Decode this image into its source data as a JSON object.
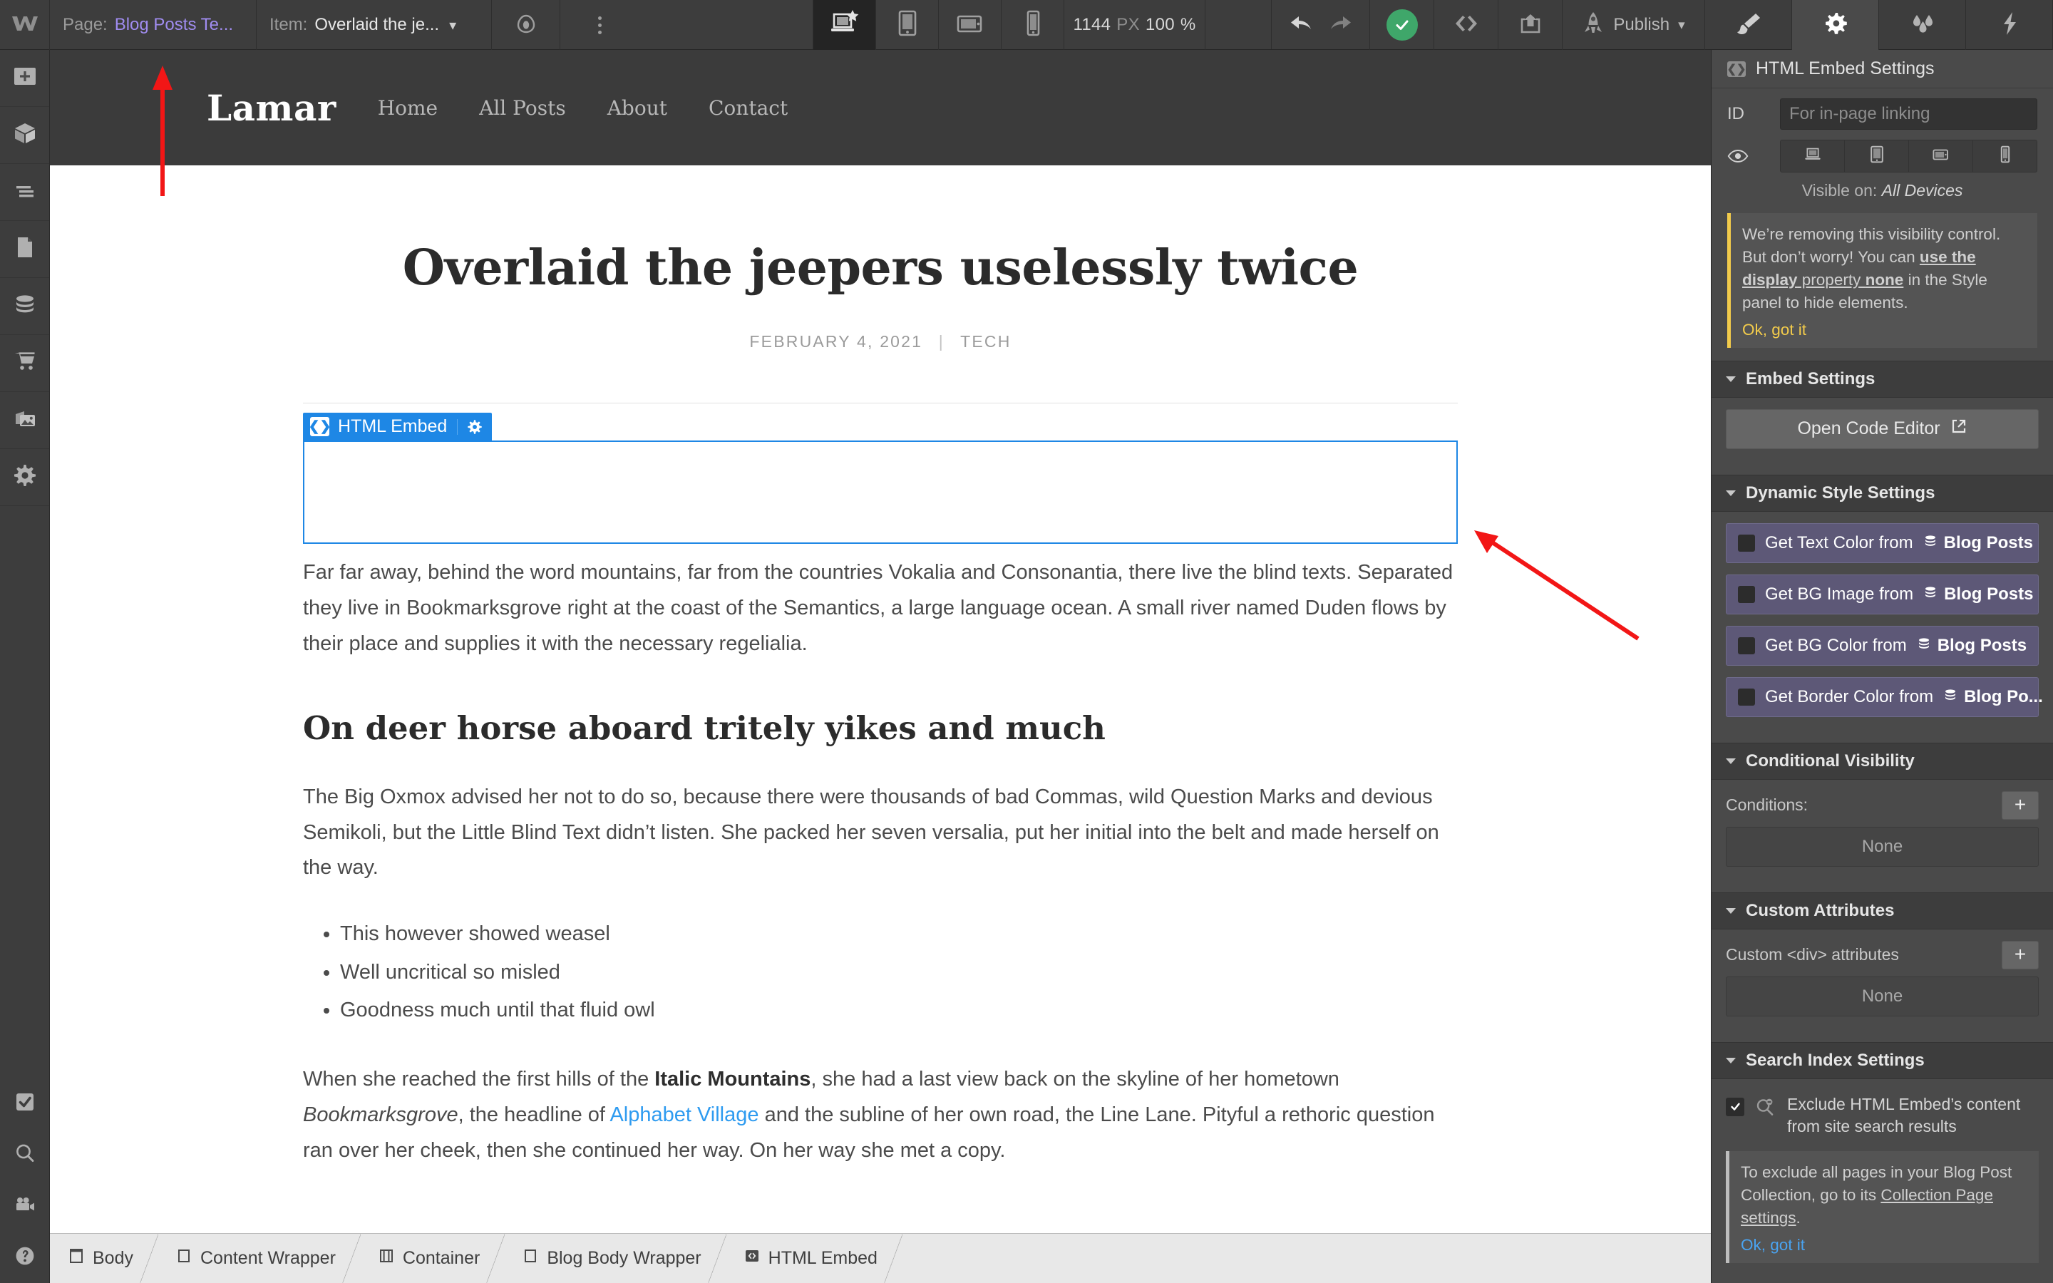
{
  "topbar": {
    "logo_icon": "webflow-logo-icon",
    "page_label": "Page:",
    "page_value": "Blog Posts Te...",
    "item_label": "Item:",
    "item_value": "Overlaid the je...",
    "preview_icon": "preview-eye-icon",
    "more_icon": "more-vertical-icon",
    "breakpoints": [
      {
        "name": "desktop-large-breakpoint",
        "icon": "laptop-star-icon",
        "active": true
      },
      {
        "name": "tablet-breakpoint",
        "icon": "tablet-portrait-icon",
        "active": false
      },
      {
        "name": "mobile-landscape-breakpoint",
        "icon": "mobile-landscape-icon",
        "active": false
      },
      {
        "name": "mobile-portrait-breakpoint",
        "icon": "mobile-portrait-icon",
        "active": false
      }
    ],
    "viewport_width": "1144",
    "viewport_unit": "PX",
    "zoom_value": "100",
    "zoom_unit": "%",
    "undo_icon": "undo-arrow-icon",
    "redo_icon": "redo-arrow-icon",
    "save_status_icon": "saved-check-icon",
    "code_icon": "code-brackets-icon",
    "export_icon": "share-export-icon",
    "publish_icon": "rocket-icon",
    "publish_label": "Publish",
    "publish_caret": "chevron-down-icon",
    "panel_tabs": [
      {
        "name": "style-panel-tab",
        "icon": "paintbrush-icon",
        "active": false
      },
      {
        "name": "settings-panel-tab",
        "icon": "gear-icon",
        "active": true
      },
      {
        "name": "interactions-panel-tab",
        "icon": "water-drops-icon",
        "active": false
      },
      {
        "name": "effects-panel-tab",
        "icon": "lightning-bolt-icon",
        "active": false
      }
    ]
  },
  "left_rail": {
    "top_items": [
      {
        "name": "add-elements-button",
        "icon": "plus-square-icon"
      },
      {
        "name": "components-button",
        "icon": "cube-icon"
      },
      {
        "name": "navigator-button",
        "icon": "navigator-lines-icon"
      },
      {
        "name": "pages-button",
        "icon": "page-document-icon"
      },
      {
        "name": "cms-collections-button",
        "icon": "database-stack-icon"
      },
      {
        "name": "ecommerce-button",
        "icon": "shopping-cart-icon"
      },
      {
        "name": "assets-button",
        "icon": "images-icon"
      },
      {
        "name": "settings-button",
        "icon": "gear-icon"
      }
    ],
    "bottom_items": [
      {
        "name": "audit-button",
        "icon": "checkbox-check-icon"
      },
      {
        "name": "search-button",
        "icon": "magnifier-icon"
      },
      {
        "name": "video-tutorials-button",
        "icon": "video-camera-icon"
      },
      {
        "name": "help-button",
        "icon": "question-circle-icon"
      }
    ]
  },
  "canvas": {
    "site_logo": "Lamar",
    "site_nav": [
      "Home",
      "All Posts",
      "About",
      "Contact"
    ],
    "article": {
      "title": "Overlaid the jeepers uselessly twice",
      "date": "FEBRUARY 4, 2021",
      "meta_separator": "|",
      "category": "TECH",
      "embed_badge": {
        "icon": "code-brackets-icon",
        "label": "HTML Embed",
        "gear_icon": "gear-icon"
      },
      "paragraph_1": "Far far away, behind the word mountains, far from the countries Vokalia and Consonantia, there live the blind texts. Separated they live in Bookmarksgrove right at the coast of the Semantics, a large language ocean. A small river named Duden flows by their place and supplies it with the necessary regelialia.",
      "heading_2": "On deer horse aboard tritely yikes and much",
      "paragraph_2": "The Big Oxmox advised her not to do so, because there were thousands of bad Commas, wild Question Marks and devious Semikoli, but the Little Blind Text didn’t listen. She packed her seven versalia, put her initial into the belt and made herself on the way.",
      "list_items": [
        "This however showed weasel",
        "Well uncritical so misled",
        "Goodness much until that fluid owl"
      ],
      "paragraph_3_a": "When she reached the first hills of the ",
      "paragraph_3_bold": "Italic Mountains",
      "paragraph_3_b": ", she had a last view back on the skyline of her hometown ",
      "paragraph_3_italic": "Bookmarksgrove",
      "paragraph_3_c": ", the headline of ",
      "paragraph_3_link": "Alphabet Village",
      "paragraph_3_d": " and the subline of her own road, the Line Lane. Pityful a rethoric question ran over her cheek, then she continued her way. On her way she met a copy."
    }
  },
  "right_panel": {
    "header_icon": "code-brackets-icon",
    "header_title": "HTML Embed Settings",
    "id_label": "ID",
    "id_placeholder": "For in-page linking",
    "visibility_icon": "eye-icon",
    "visibility_devices": [
      {
        "name": "visible-desktop-toggle",
        "icon": "laptop-icon"
      },
      {
        "name": "visible-tablet-toggle",
        "icon": "tablet-portrait-icon"
      },
      {
        "name": "visible-mobile-landscape-toggle",
        "icon": "mobile-landscape-icon"
      },
      {
        "name": "visible-mobile-portrait-toggle",
        "icon": "mobile-portrait-icon"
      }
    ],
    "visible_on_label": "Visible on:",
    "visible_on_value": "All Devices",
    "visibility_notice": {
      "text_1": "We’re removing this visibility control. But don’t worry! You can ",
      "link_1": "use the display",
      "text_2": " property ",
      "bold_1": "none",
      "text_3": " in the Style panel to hide elements.",
      "dismiss": "Ok, got it"
    },
    "sections": {
      "embed_settings": {
        "title": "Embed Settings",
        "caret": "caret-down-icon",
        "open_code_editor": "Open Code Editor",
        "open_code_editor_icon": "external-link-icon"
      },
      "dynamic_style_settings": {
        "title": "Dynamic Style Settings",
        "caret": "caret-down-icon",
        "buttons": [
          {
            "label": "Get Text Color from",
            "source": "Blog Posts",
            "source_icon": "database-stack-icon"
          },
          {
            "label": "Get BG Image from",
            "source": "Blog Posts",
            "source_icon": "database-stack-icon"
          },
          {
            "label": "Get BG Color from",
            "source": "Blog Posts",
            "source_icon": "database-stack-icon"
          },
          {
            "label": "Get Border Color from",
            "source": "Blog Po...",
            "source_icon": "database-stack-icon"
          }
        ]
      },
      "conditional_visibility": {
        "title": "Conditional Visibility",
        "caret": "caret-down-icon",
        "field_label": "Conditions:",
        "add_icon": "plus-icon",
        "value": "None"
      },
      "custom_attributes": {
        "title": "Custom Attributes",
        "caret": "caret-down-icon",
        "field_label": "Custom <div> attributes",
        "add_icon": "plus-icon",
        "value": "None"
      },
      "search_index_settings": {
        "title": "Search Index Settings",
        "caret": "caret-down-icon",
        "checkbox_checked": true,
        "checkbox_icon": "check-icon",
        "exclude_icon": "search-minus-icon",
        "exclude_label": "Exclude HTML Embed’s content from site search results",
        "notice_text_1": "To exclude all pages in your Blog Post Collection, go to its ",
        "notice_link": "Collection Page settings",
        "notice_text_2": ".",
        "notice_dismiss": "Ok, got it"
      }
    }
  },
  "breadcrumb": {
    "items": [
      {
        "label": "Body",
        "icon": "body-icon"
      },
      {
        "label": "Content Wrapper",
        "icon": "div-icon"
      },
      {
        "label": "Container",
        "icon": "container-icon"
      },
      {
        "label": "Blog Body Wrapper",
        "icon": "div-icon"
      },
      {
        "label": "HTML Embed",
        "icon": "code-brackets-icon"
      }
    ]
  },
  "annotations": {
    "arrow_color": "#f21616",
    "arrows": [
      {
        "name": "arrow-pointing-to-navbar"
      },
      {
        "name": "arrow-pointing-to-html-embed"
      }
    ]
  },
  "colors": {
    "accent_purple": "#a08cf0",
    "selection_blue": "#1e87e5",
    "dynamic_purple": "#5d5877",
    "warning_yellow": "#f2cb4b",
    "save_green": "#3fa76a",
    "link_blue": "#2e9bf0"
  }
}
